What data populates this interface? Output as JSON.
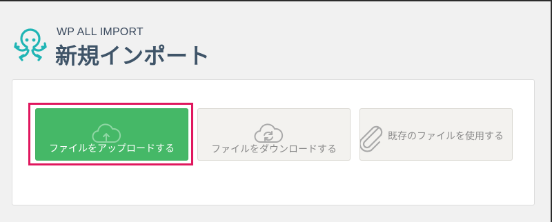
{
  "brand": {
    "name": "WP ALL IMPORT",
    "page_title": "新規インポート",
    "logo_icon": "octopus-logo-icon"
  },
  "import_options": [
    {
      "label": "ファイルをアップロードする",
      "icon": "cloud-upload-icon",
      "selected": true
    },
    {
      "label": "ファイルをダウンロードする",
      "icon": "cloud-download-icon",
      "selected": false
    },
    {
      "label": "既存のファイルを使用する",
      "icon": "paperclip-icon",
      "selected": false
    }
  ],
  "colors": {
    "upload_button": "#45b867",
    "highlight_border": "#e0175e",
    "logo_accent": "#20b5b5",
    "title_text": "#3f5468"
  }
}
